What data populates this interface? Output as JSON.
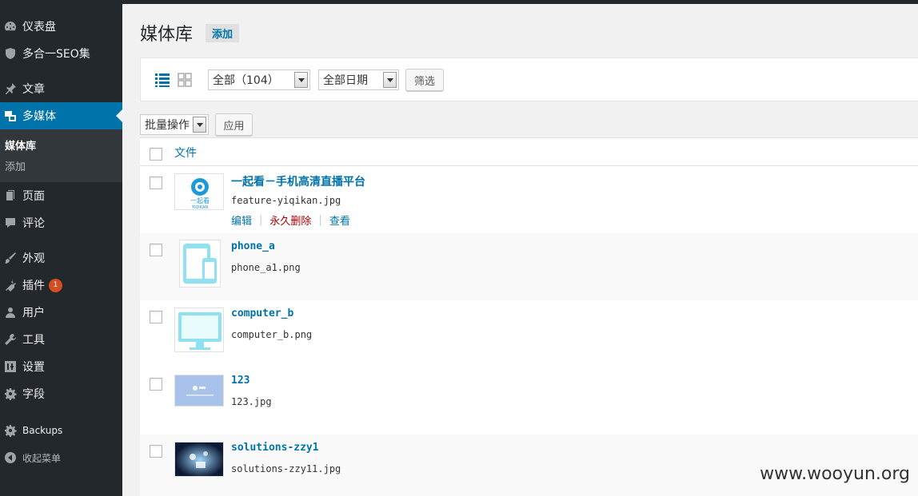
{
  "sidebar": {
    "items": [
      {
        "label": "仪表盘",
        "icon": "dashboard-icon"
      },
      {
        "label": "多合一SEO集",
        "icon": "shield-icon"
      },
      {
        "label": "文章",
        "icon": "pin-icon"
      },
      {
        "label": "多媒体",
        "icon": "media-icon"
      },
      {
        "label": "页面",
        "icon": "page-icon"
      },
      {
        "label": "评论",
        "icon": "comment-icon"
      },
      {
        "label": "外观",
        "icon": "brush-icon"
      },
      {
        "label": "插件",
        "icon": "plugin-icon",
        "badge": "1"
      },
      {
        "label": "用户",
        "icon": "user-icon"
      },
      {
        "label": "工具",
        "icon": "wrench-icon"
      },
      {
        "label": "设置",
        "icon": "settings-icon"
      },
      {
        "label": "字段",
        "icon": "gear-icon"
      },
      {
        "label": "Backups",
        "icon": "gear-icon"
      },
      {
        "label": "收起菜单",
        "icon": "collapse-icon"
      }
    ],
    "submenu": [
      "媒体库",
      "添加"
    ]
  },
  "header": {
    "title": "媒体库",
    "add_new": "添加"
  },
  "toolbar": {
    "type_filter": "全部（104）",
    "date_filter": "全部日期",
    "filter_button": "筛选"
  },
  "bulk": {
    "select": "批量操作",
    "apply": "应用"
  },
  "table": {
    "column_file": "文件",
    "rows": [
      {
        "title": "一起看－手机高清直播平台",
        "filename": "feature-yiqikan.jpg",
        "thumb": "yiqikan-logo",
        "thumb_text": "一起看",
        "thumb_subtext": "YIQIKAN"
      },
      {
        "title": "phone_a",
        "filename": "phone_a1.png",
        "thumb": "phone"
      },
      {
        "title": "computer_b",
        "filename": "computer_b.png",
        "thumb": "computer"
      },
      {
        "title": "123",
        "filename": "123.jpg",
        "thumb": "blue-banner"
      },
      {
        "title": "solutions-zzy1",
        "filename": "solutions-zzy11.jpg",
        "thumb": "dark-photo"
      }
    ],
    "row_actions": {
      "edit": "编辑",
      "delete": "永久删除",
      "view": "查看"
    }
  },
  "watermark": "www.wooyun.org",
  "colors": {
    "sidebar": "#23282d",
    "active": "#0073aa",
    "badge": "#d54e21",
    "link": "#0073aa",
    "delete": "#aa0000"
  }
}
